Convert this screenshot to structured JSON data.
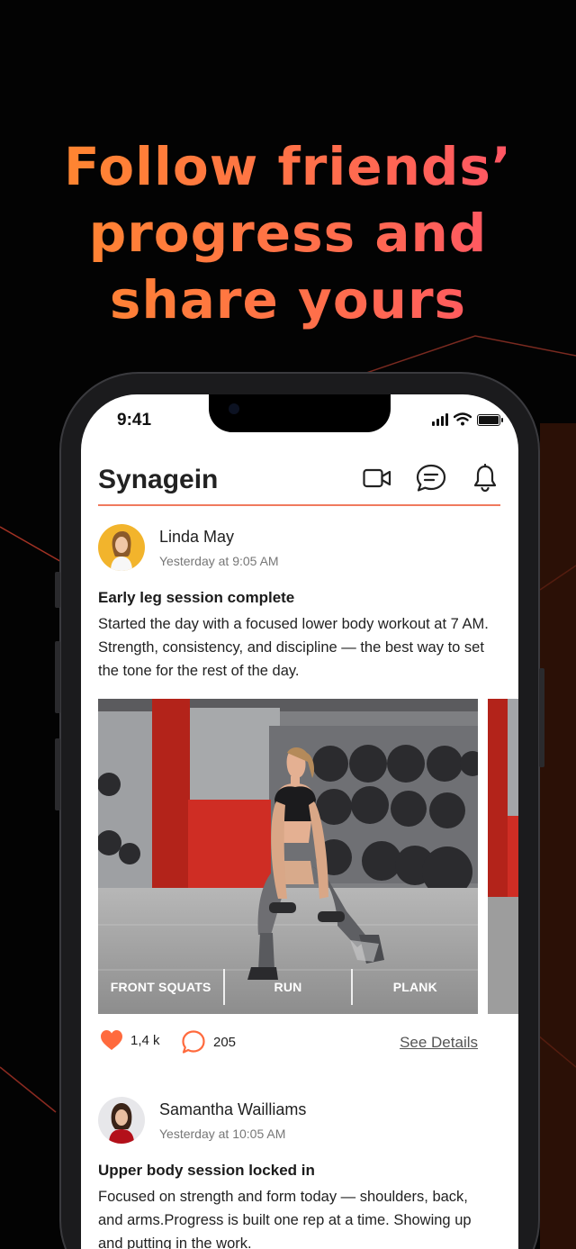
{
  "headline": {
    "line1": "Follow friends’",
    "line2": "progress and",
    "line3": "share yours"
  },
  "status_bar": {
    "time": "9:41"
  },
  "app": {
    "title": "Synagein",
    "actions": [
      "video-icon",
      "chat-icon",
      "bell-icon"
    ]
  },
  "posts": [
    {
      "author": "Linda May",
      "time": "Yesterday at 9:05 AM",
      "title": "Early leg session complete",
      "body": "Started the day with a focused lower body workout at 7 AM. Strength, consistency, and discipline — the best way to set the tone for the rest of the day.",
      "tags": [
        "FRONT SQUATS",
        "RUN",
        "PLANK"
      ],
      "likes": "1,4 k",
      "comments": "205",
      "details_label": "See Details"
    },
    {
      "author": "Samantha Wailliams",
      "time": "Yesterday at 10:05 AM",
      "title": "Upper body session locked in",
      "body": "Focused on strength and form today — shoulders, back, and arms.Progress is built one rep at a time. Showing up and putting in the work."
    }
  ],
  "colors": {
    "accent": "#f07a5e",
    "heart": "#ff6a3d",
    "headline_start": "#ff8a2a",
    "headline_end": "#ff4d6d"
  }
}
